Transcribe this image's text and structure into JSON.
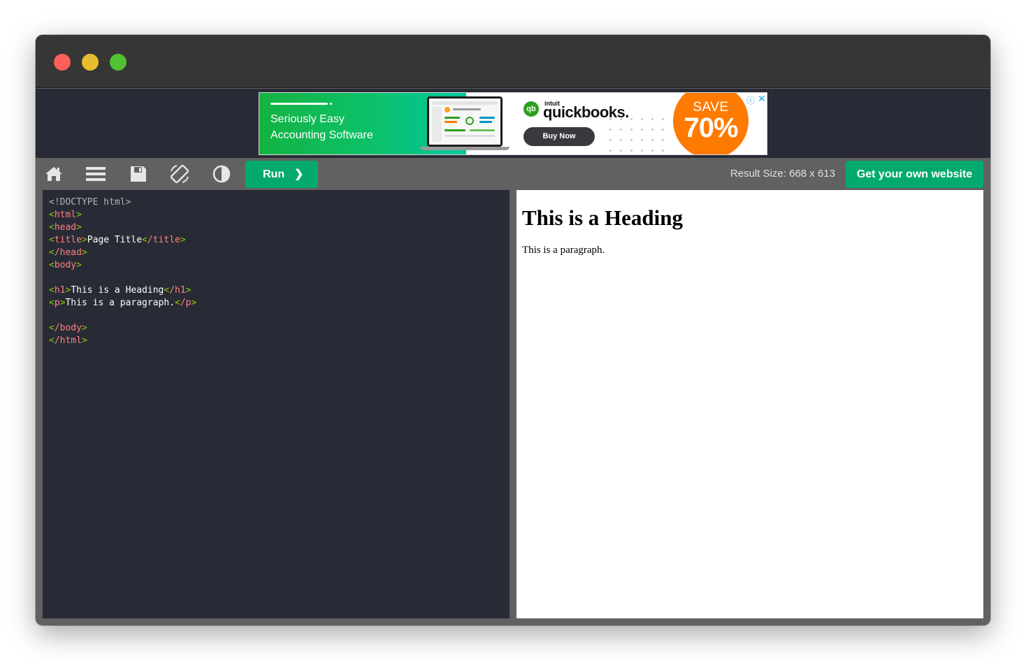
{
  "ad": {
    "tagline": [
      "Seriously Easy",
      "Accounting Software"
    ],
    "brand_prefix": "intuit",
    "brand_name": "quickbooks.",
    "brand_logo": "qb",
    "cta": "Buy Now",
    "save_word": "SAVE",
    "save_percent": "70%",
    "choices_icon": "ⓘ",
    "close_icon": "✕"
  },
  "toolbar": {
    "icons": [
      "home-icon",
      "menu-icon",
      "save-icon",
      "rotate-icon",
      "contrast-icon"
    ],
    "run_label": "Run",
    "run_chevron": "❯",
    "result_size": "Result Size: 668 x 613",
    "own_website_label": "Get your own website"
  },
  "editor": {
    "line1": "<!DOCTYPE html>",
    "tags": {
      "html_open": "html",
      "head_open": "head",
      "title_open": "title",
      "title_close": "/title",
      "head_close": "/head",
      "body_open": "body",
      "h1_open": "h1",
      "h1_close": "/h1",
      "p_open": "p",
      "p_close": "/p",
      "body_close": "/body",
      "html_close": "/html"
    },
    "title_text": "Page Title",
    "h1_text": "This is a Heading",
    "p_text": "This is a paragraph."
  },
  "result": {
    "heading": "This is a Heading",
    "paragraph": "This is a paragraph."
  },
  "colors": {
    "accent_green": "#04aa6d",
    "editor_bg": "#282a35",
    "tag_color": "#ff8282",
    "bracket_color": "#88ce02",
    "save_orange": "#ff7a00"
  }
}
